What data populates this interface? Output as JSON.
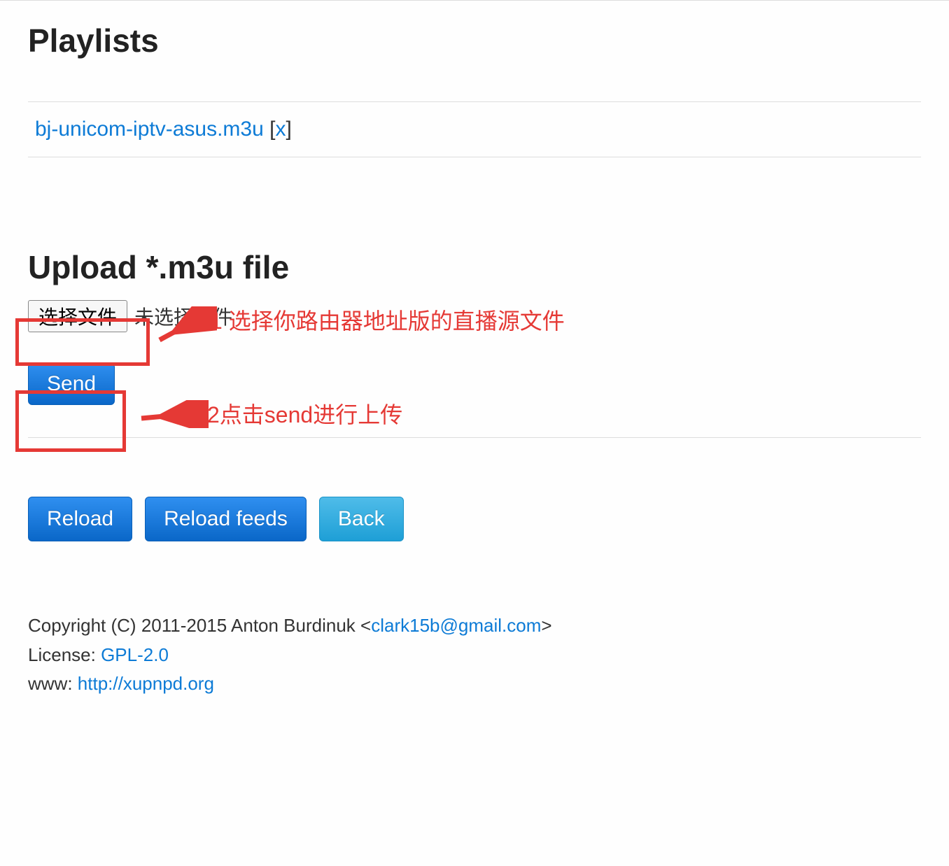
{
  "titles": {
    "playlists": "Playlists",
    "upload": "Upload *.m3u file"
  },
  "playlists": [
    {
      "filename": "bj-unicom-iptv-asus.m3u",
      "delete_label": "x"
    }
  ],
  "file_input": {
    "choose_label": "选择文件",
    "no_file_label": "未选择文件"
  },
  "buttons": {
    "send": "Send",
    "reload": "Reload",
    "reload_feeds": "Reload feeds",
    "back": "Back"
  },
  "annotations": {
    "step1": "1 选择你路由器地址版的直播源文件",
    "step2": "2点击send进行上传"
  },
  "footer": {
    "copyright_prefix": "Copyright (C) 2011-2015 Anton Burdinuk <",
    "email": "clark15b@gmail.com",
    "copyright_suffix": ">",
    "license_label": "License: ",
    "license_value": "GPL-2.0",
    "www_label": "www: ",
    "www_value": "http://xupnpd.org"
  }
}
